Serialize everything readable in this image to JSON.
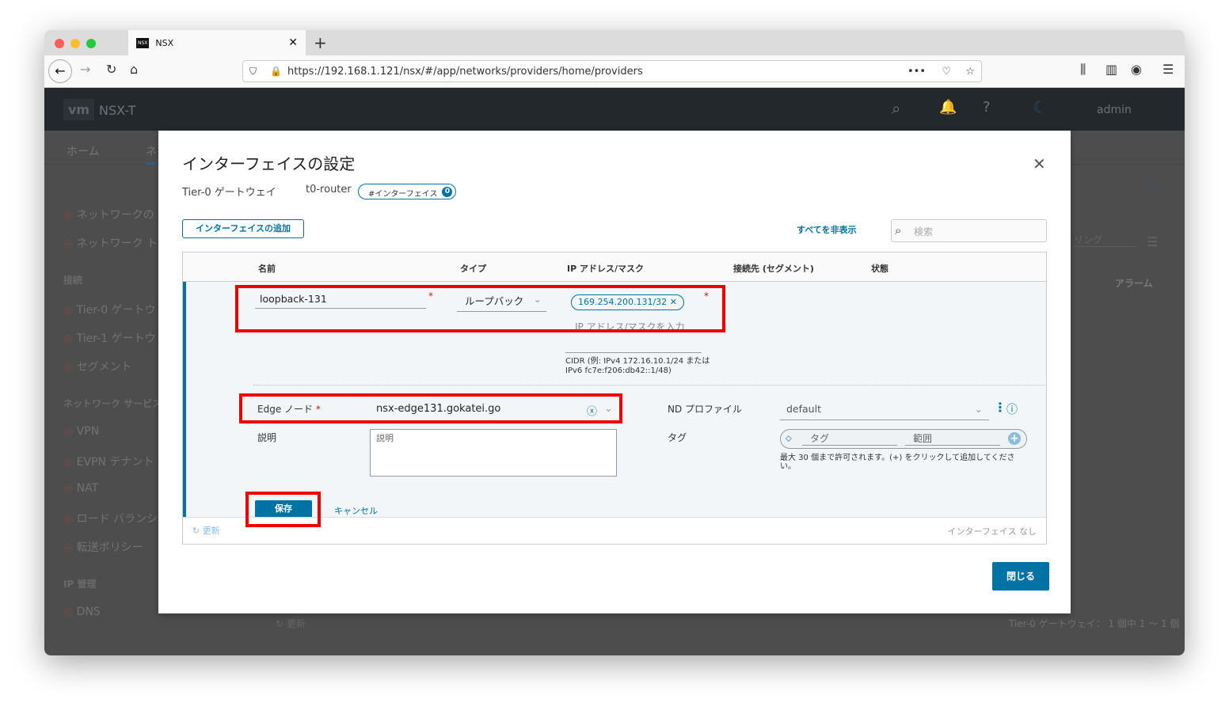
{
  "browser": {
    "tab_title": "NSX",
    "url": "https://192.168.1.121/nsx/#/app/networks/providers/home/providers",
    "new_tab": "+"
  },
  "app": {
    "logo": "vm",
    "product": "NSX-T",
    "user": "admin",
    "nav_tabs": [
      "ホーム",
      "ネ"
    ],
    "sidebar": [
      {
        "type": "item",
        "label": "ネットワークの"
      },
      {
        "type": "item",
        "label": "ネットワーク ト"
      },
      {
        "type": "section",
        "label": "接続"
      },
      {
        "type": "item",
        "label": "Tier-0 ゲートウ"
      },
      {
        "type": "item",
        "label": "Tier-1 ゲートウ"
      },
      {
        "type": "item",
        "label": "セグメント"
      },
      {
        "type": "section",
        "label": "ネットワーク サービス"
      },
      {
        "type": "item",
        "label": "VPN"
      },
      {
        "type": "item",
        "label": "EVPN テナント"
      },
      {
        "type": "item",
        "label": "NAT"
      },
      {
        "type": "item",
        "label": "ロード バランシ"
      },
      {
        "type": "item",
        "label": "転送ポリシー"
      },
      {
        "type": "section",
        "label": "IP 管理"
      },
      {
        "type": "item",
        "label": "DNS"
      }
    ],
    "bg_alarm": "アラーム",
    "bg_footer": "Tier-0 ゲートウェイ： 1 個中 1 ～ 1 個",
    "bg_refresh": "更新",
    "bg_filter": "リング"
  },
  "modal": {
    "title": "インターフェイスの設定",
    "gateway_label": "Tier-0 ゲートウェイ",
    "gateway_name": "t0-router",
    "badge_label": "#インターフェイス",
    "badge_count": "0",
    "add_button": "インターフェイスの追加",
    "hide_all": "すべてを非表示",
    "search_placeholder": "検索",
    "columns": [
      "名前",
      "タイプ",
      "IP アドレス/マスク",
      "接続先 (セグメント)",
      "状態"
    ],
    "form": {
      "name_value": "loopback-131",
      "type_value": "ループバック",
      "ip_chip": "169.254.200.131/32",
      "ip_placeholder": "IP アドレス/マスクを入力",
      "ip_help": "CIDR (例: IPv4 172.16.10.1/24 または IPv6 fc7e:f206:db42::1/48)",
      "edge_label": "Edge ノード",
      "edge_value": "nsx-edge131.gokatei.go",
      "nd_label": "ND プロファイル",
      "nd_value": "default",
      "desc_label": "説明",
      "desc_placeholder": "説明",
      "tag_label": "タグ",
      "tag_placeholder": "タグ",
      "scope_placeholder": "範囲",
      "tag_help": "最大 30 個まで許可されます。(+) をクリックして追加してください。",
      "required": "*",
      "save": "保存",
      "cancel": "キャンセル"
    },
    "refresh": "更新",
    "empty": "インターフェイス なし",
    "close": "閉じる"
  },
  "colors": {
    "accent": "#0072a3",
    "highlight": "#e00000"
  }
}
